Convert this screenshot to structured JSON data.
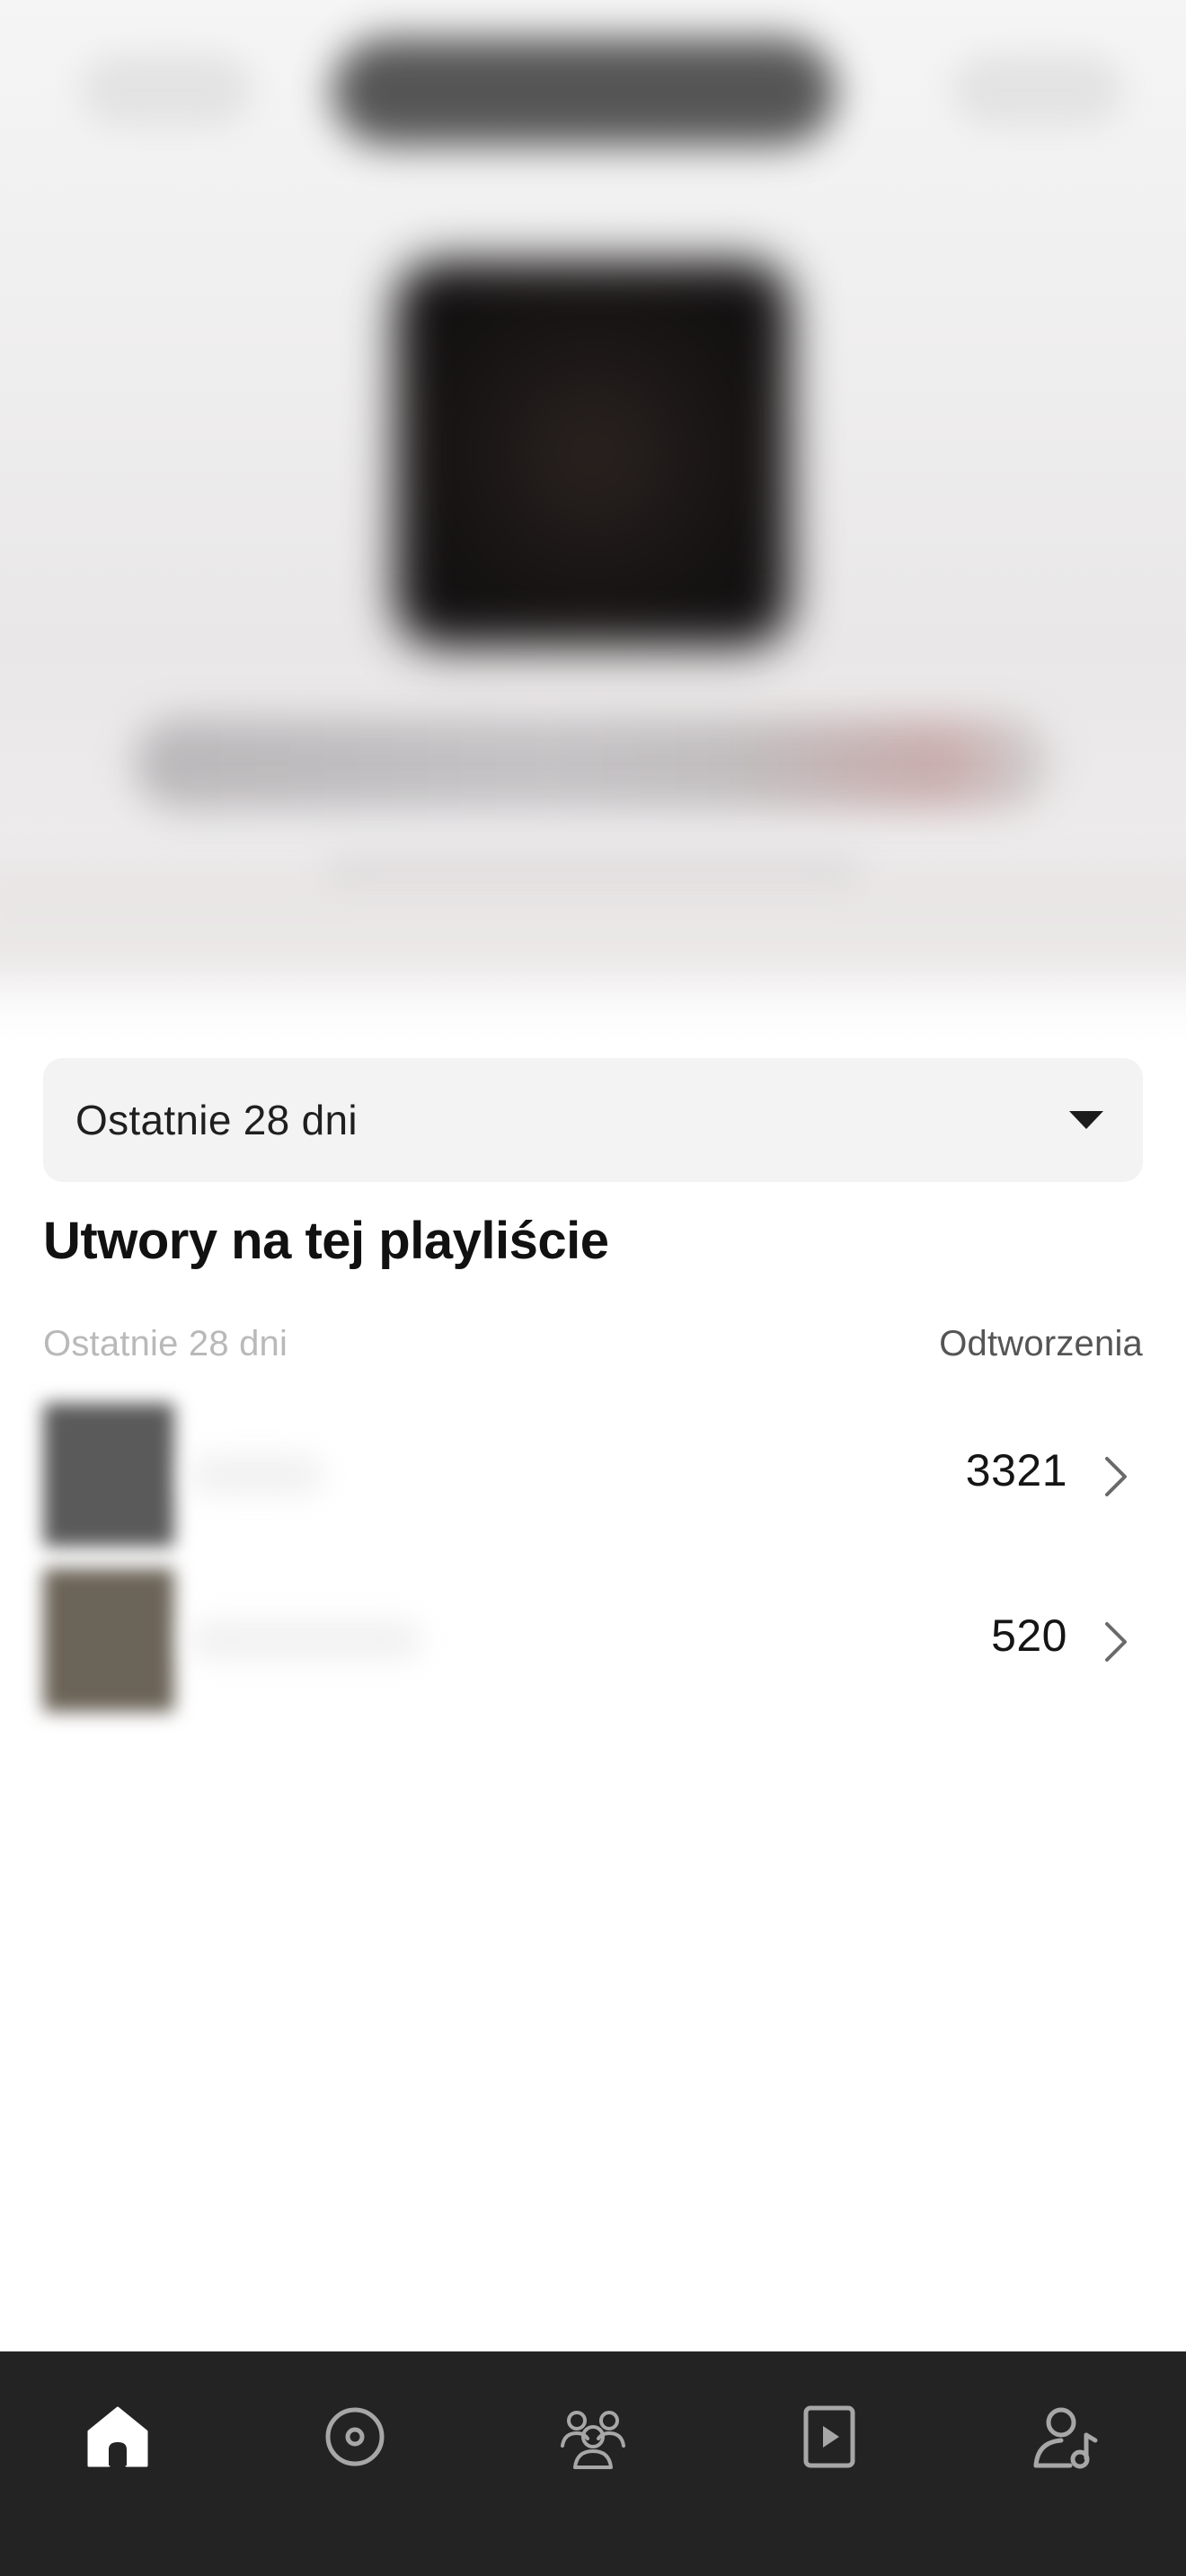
{
  "period_selector": {
    "label": "Ostatnie 28 dni"
  },
  "section": {
    "title": "Utwory na tej playliście",
    "column_left": "Ostatnie 28 dni",
    "column_right": "Odtworzenia"
  },
  "tracks": [
    {
      "plays": "3321",
      "thumb_color": "#5a5a5a"
    },
    {
      "plays": "520",
      "thumb_color": "#6b6458"
    }
  ],
  "bottom_nav": {
    "items": [
      {
        "name": "home-icon",
        "active": true
      },
      {
        "name": "music-disc-icon",
        "active": false
      },
      {
        "name": "audience-icon",
        "active": false
      },
      {
        "name": "video-play-icon",
        "active": false
      },
      {
        "name": "artist-profile-icon",
        "active": false
      }
    ]
  },
  "colors": {
    "nav_background": "#232323",
    "nav_active": "#ffffff",
    "nav_inactive": "#a7a7a7"
  }
}
